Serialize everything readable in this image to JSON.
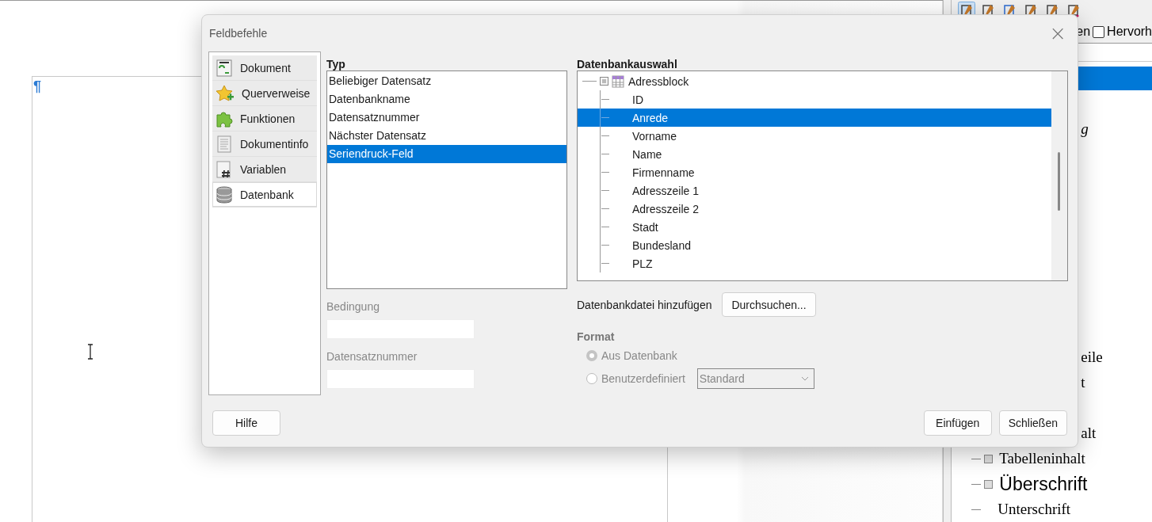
{
  "document": {
    "paragraph_mark": "¶"
  },
  "sidebar": {
    "toolbar": [
      {
        "selected": true
      },
      {
        "selected": false
      },
      {
        "selected": false
      },
      {
        "selected": false
      },
      {
        "selected": false
      },
      {
        "selected": false
      }
    ],
    "filter_fragment": "en",
    "highlight_checkbox": {
      "label": "Hervorh",
      "checked": false
    },
    "styles": [
      {
        "kind": "hidden",
        "selected": true
      },
      {
        "kind": "fragment",
        "label": "g",
        "italic": true,
        "selected": false
      },
      {
        "kind": "fragment",
        "label": "eile",
        "italic": false,
        "selected": false
      },
      {
        "kind": "fragment",
        "label": "t",
        "italic": false,
        "selected": false
      },
      {
        "kind": "fragment",
        "label": "alt",
        "italic": false,
        "selected": false
      },
      {
        "kind": "full",
        "label": "Tabelleninhalt",
        "expandable": true,
        "heading": false,
        "selected": false
      },
      {
        "kind": "full",
        "label": "Überschrift",
        "expandable": true,
        "heading": true,
        "selected": false
      },
      {
        "kind": "full",
        "label": "Unterschrift",
        "expandable": false,
        "heading": false,
        "selected": false
      }
    ]
  },
  "dialog": {
    "title": "Feldbefehle",
    "close": "×",
    "nav": [
      {
        "label": "Dokument",
        "selected": false
      },
      {
        "label": "Querverweise",
        "selected": false
      },
      {
        "label": "Funktionen",
        "selected": false
      },
      {
        "label": "Dokumentinfo",
        "selected": false
      },
      {
        "label": "Variablen",
        "selected": false
      },
      {
        "label": "Datenbank",
        "selected": true
      }
    ],
    "type_label": "Typ",
    "types": [
      {
        "label": "Beliebiger Datensatz",
        "selected": false
      },
      {
        "label": "Datenbankname",
        "selected": false
      },
      {
        "label": "Datensatznummer",
        "selected": false
      },
      {
        "label": "Nächster Datensatz",
        "selected": false
      },
      {
        "label": "Seriendruck-Feld",
        "selected": true
      }
    ],
    "condition": {
      "label": "Bedingung",
      "disabled": true
    },
    "record_number": {
      "label": "Datensatznummer",
      "disabled": true
    },
    "db_label": "Datenbankauswahl",
    "tree": [
      {
        "label": "Adressblock",
        "expanded": true,
        "children": [
          {
            "label": "ID",
            "selected": false
          },
          {
            "label": "Anrede",
            "selected": true
          },
          {
            "label": "Vorname",
            "selected": false
          },
          {
            "label": "Name",
            "selected": false
          },
          {
            "label": "Firmenname",
            "selected": false
          },
          {
            "label": "Adresszeile 1",
            "selected": false
          },
          {
            "label": "Adresszeile 2",
            "selected": false
          },
          {
            "label": "Stadt",
            "selected": false
          },
          {
            "label": "Bundesland",
            "selected": false
          },
          {
            "label": "PLZ",
            "selected": false
          }
        ]
      }
    ],
    "add_db_label": "Datenbankdatei hinzufügen",
    "browse_button": "Durchsuchen...",
    "format": {
      "label": "Format",
      "disabled": true,
      "options": [
        {
          "label": "Aus Datenbank",
          "selected": true
        },
        {
          "label": "Benutzerdefiniert",
          "selected": false
        }
      ],
      "combo_value": "Standard"
    },
    "buttons": {
      "help": "Hilfe",
      "insert": "Einfügen",
      "close": "Schließen"
    }
  }
}
